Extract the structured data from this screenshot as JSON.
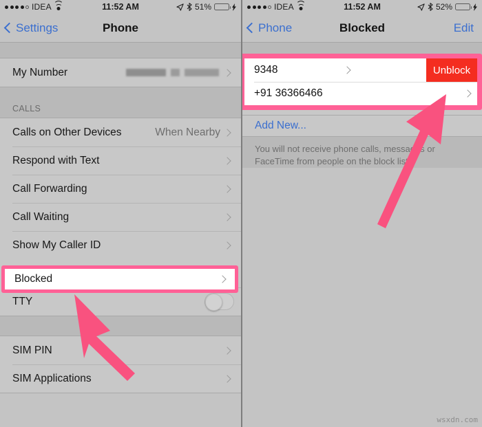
{
  "left": {
    "status": {
      "carrier": "IDEA",
      "signal_dots_filled": 4,
      "signal_dots_total": 5,
      "wifi_icon": "wifi-icon",
      "time": "11:52 AM",
      "location_icon": "location-arrow-icon",
      "bluetooth_icon": "bluetooth-icon",
      "battery_percent": "51%",
      "battery_level": 51,
      "battery_color": "#4cd964",
      "charging_icon": "lightning-bolt-icon"
    },
    "nav": {
      "back_label": "Settings",
      "title": "Phone"
    },
    "my_number": {
      "label": "My Number",
      "value_redacted": true
    },
    "section_calls": "CALLS",
    "rows": [
      {
        "label": "Calls on Other Devices",
        "value": "When Nearby",
        "accessory": "chevron"
      },
      {
        "label": "Respond with Text",
        "value": "",
        "accessory": "chevron"
      },
      {
        "label": "Call Forwarding",
        "value": "",
        "accessory": "chevron"
      },
      {
        "label": "Call Waiting",
        "value": "",
        "accessory": "chevron"
      },
      {
        "label": "Show My Caller ID",
        "value": "",
        "accessory": "chevron"
      }
    ],
    "highlighted_row": {
      "label": "Blocked",
      "accessory": "chevron"
    },
    "tty_row": {
      "label": "TTY",
      "toggle_on": false
    },
    "sim_rows": [
      {
        "label": "SIM PIN",
        "accessory": "chevron"
      },
      {
        "label": "SIM Applications",
        "accessory": "chevron"
      }
    ]
  },
  "right": {
    "status": {
      "carrier": "IDEA",
      "signal_dots_filled": 4,
      "signal_dots_total": 5,
      "wifi_icon": "wifi-icon",
      "time": "11:52 AM",
      "location_icon": "location-arrow-icon",
      "bluetooth_icon": "bluetooth-icon",
      "battery_percent": "52%",
      "battery_level": 52,
      "battery_color": "#4cd964",
      "charging_icon": "lightning-bolt-icon"
    },
    "nav": {
      "back_label": "Phone",
      "title": "Blocked",
      "edit_label": "Edit"
    },
    "blocked_entries": [
      {
        "number": "9348",
        "accessory": "chevron",
        "swipe_action": "Unblock"
      },
      {
        "number": "+91 36366466",
        "accessory": "chevron",
        "swipe_action": ""
      }
    ],
    "add_new_label": "Add New...",
    "footnote": "You will not receive phone calls, messages or FaceTime from people on the block list."
  },
  "annotations": {
    "highlight_color": "#ff6196",
    "arrow_color": "#f9527f",
    "unblock_button_color": "#f42d20",
    "link_color": "#3b6fcf",
    "left_arrow_points_to": "Blocked",
    "right_arrow_points_to": "+91 36366466"
  },
  "watermark": "wsxdn.com"
}
